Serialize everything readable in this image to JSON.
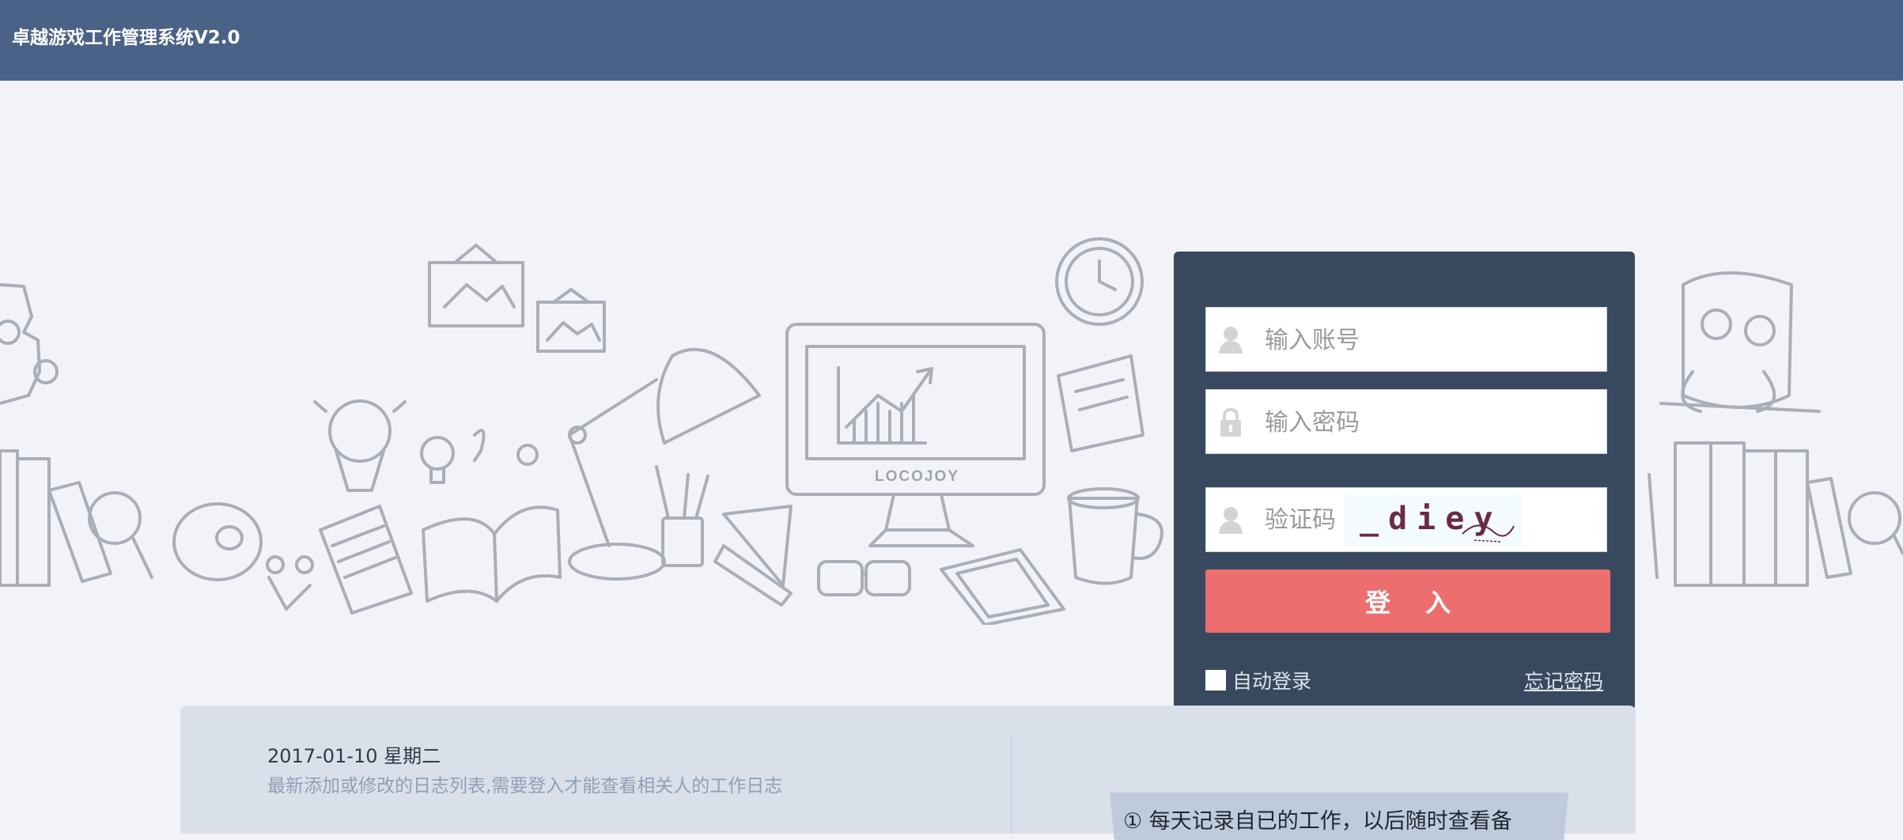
{
  "header": {
    "title": "卓越游戏工作管理系统V2.0"
  },
  "illustration": {
    "monitor_brand": "LOCOJOY"
  },
  "login": {
    "account_placeholder": "输入账号",
    "password_placeholder": "输入密码",
    "captcha_placeholder": "验证码",
    "captcha_text": "_diey",
    "submit_label": "登入",
    "remember_label": "自动登录",
    "forgot_label": "忘记密码"
  },
  "info": {
    "date": "2017-01-10 星期二",
    "subtitle": "最新添加或修改的日志列表,需要登入才能查看相关人的工作日志",
    "note": "① 每天记录自已的工作，以后随时查看备"
  },
  "colors": {
    "topbar": "#4a6286",
    "login_panel": "#38495f",
    "login_button": "#ec6e6f",
    "page_background": "#f1f3f8"
  }
}
